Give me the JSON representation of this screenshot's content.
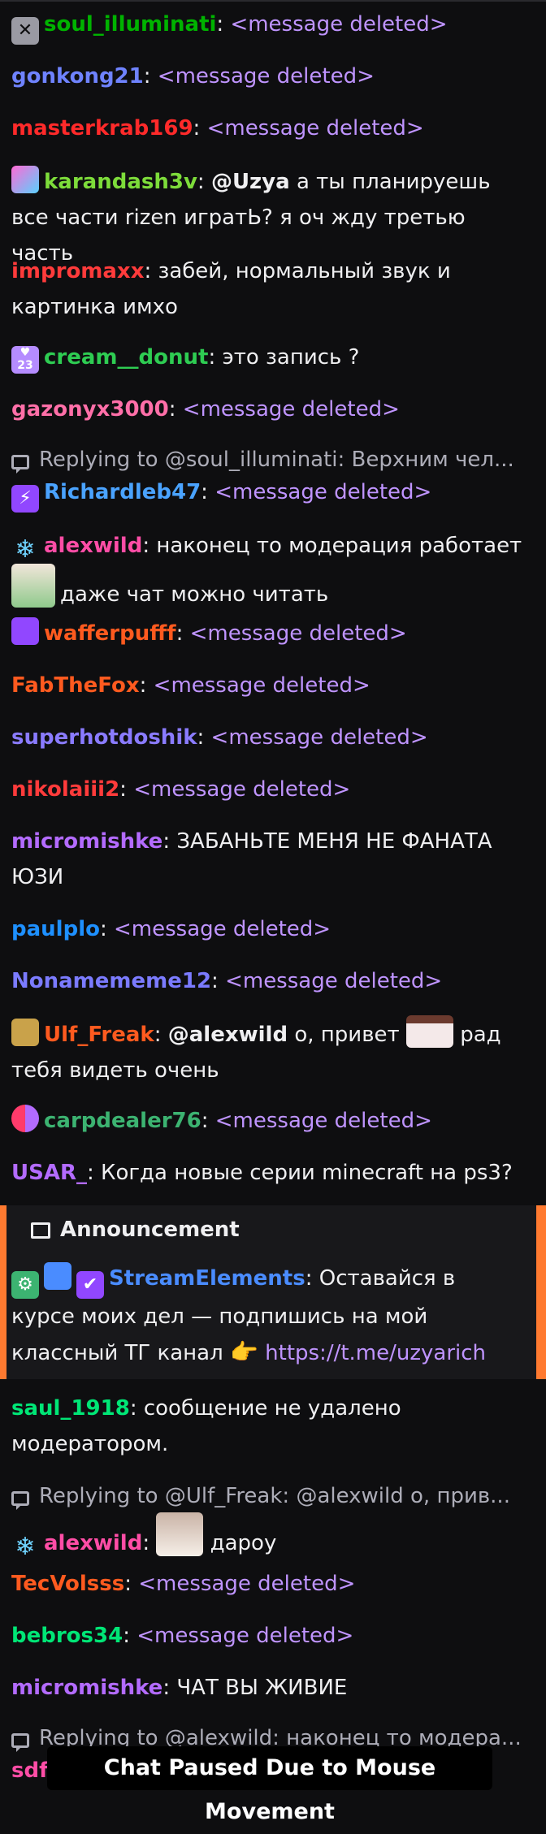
{
  "messages": [
    {
      "user": "soul_illuminati",
      "color": "#00b300",
      "text": "<message deleted>"
    },
    {
      "user": "gonkong21",
      "color": "#6f83ff",
      "text": "<message deleted>"
    },
    {
      "user": "masterkrab169",
      "color": "#ff2a2a",
      "text": "<message deleted>"
    },
    {
      "user": "karandash3v",
      "color": "#7ddc3a",
      "mention": "@Uzya",
      "text": "а ты планируешь все части rizen игратЬ? я оч жду третью часть"
    },
    {
      "user": "impromaxx",
      "color": "#ff3b3b",
      "text": "забей, нормальный звук и картинка имхо"
    },
    {
      "user": "cream__donut",
      "color": "#2ecc52",
      "text": "это запись ?"
    },
    {
      "user": "gazonyx3000",
      "color": "#ff6fa8",
      "text": "<message deleted>"
    },
    {
      "user": "Richardleb47",
      "color": "#4aa3ff",
      "text": "<message deleted>"
    },
    {
      "user": "alexwild",
      "color": "#ff4da6",
      "text": "наконец то модерация работает",
      "text2": "даже чат можно читать"
    },
    {
      "user": "wafferpufff",
      "color": "#ff5a1f",
      "text": "<message deleted>"
    },
    {
      "user": "FabTheFox",
      "color": "#ff5a1f",
      "text": "<message deleted>"
    },
    {
      "user": "superhotdoshik",
      "color": "#8a7bff",
      "text": "<message deleted>"
    },
    {
      "user": "nikolaiii2",
      "color": "#ff3b3b",
      "text": "<message deleted>"
    },
    {
      "user": "micromishke",
      "color": "#b36bff",
      "text": "ЗАБАНЬТЕ МЕНЯ НЕ ФАНАТА ЮЗИ"
    },
    {
      "user": "paulplo",
      "color": "#1e90ff",
      "text": "<message deleted>"
    },
    {
      "user": "Nonamememe12",
      "color": "#7b7bff",
      "text": "<message deleted>"
    },
    {
      "user": "Ulf_Freak",
      "color": "#ff5a1f",
      "mention": "@alexwild",
      "text": "о, привет",
      "text2": "рад тебя видеть очень"
    },
    {
      "user": "carpdealer76",
      "color": "#3cb371",
      "text": "<message deleted>"
    },
    {
      "user": "USAR_",
      "color": "#b36bff",
      "text": "Когда новые серии minecraft на ps3?"
    },
    {
      "user": "saul_1918",
      "color": "#00e676",
      "text": "сообщение не удалено модератором."
    },
    {
      "user": "alexwild",
      "color": "#ff4da6",
      "text": "дарoу"
    },
    {
      "user": "TecVolsss",
      "color": "#ff5a1f",
      "text": "<message deleted>"
    },
    {
      "user": "bebros34",
      "color": "#00e676",
      "text": "<message deleted>"
    },
    {
      "user": "micromishke",
      "color": "#b36bff",
      "text": "ЧАТ ВЫ ЖИВИЕ"
    },
    {
      "user": "sdfs",
      "color": "#ff4da6",
      "text": ""
    }
  ],
  "replies": [
    "Replying to @soul_illuminati: Верхним чел...",
    "Replying to @Ulf_Freak: @alexwild о, прив...",
    "Replying to @alexwild: наконец то модера..."
  ],
  "announcement": {
    "label": "Announcement",
    "user": "StreamElements",
    "user_color": "#4a8cff",
    "text": "Оставайся в курсе моих дел — подпишись на мой классный ТГ канал",
    "link": "https://t.me/uzyarich"
  },
  "paused_label": "Chat Paused Due to Mouse Movement",
  "colors": {
    "background": "#0e0e10",
    "deleted": "#bf94ff",
    "accent": "#ff7a30"
  }
}
